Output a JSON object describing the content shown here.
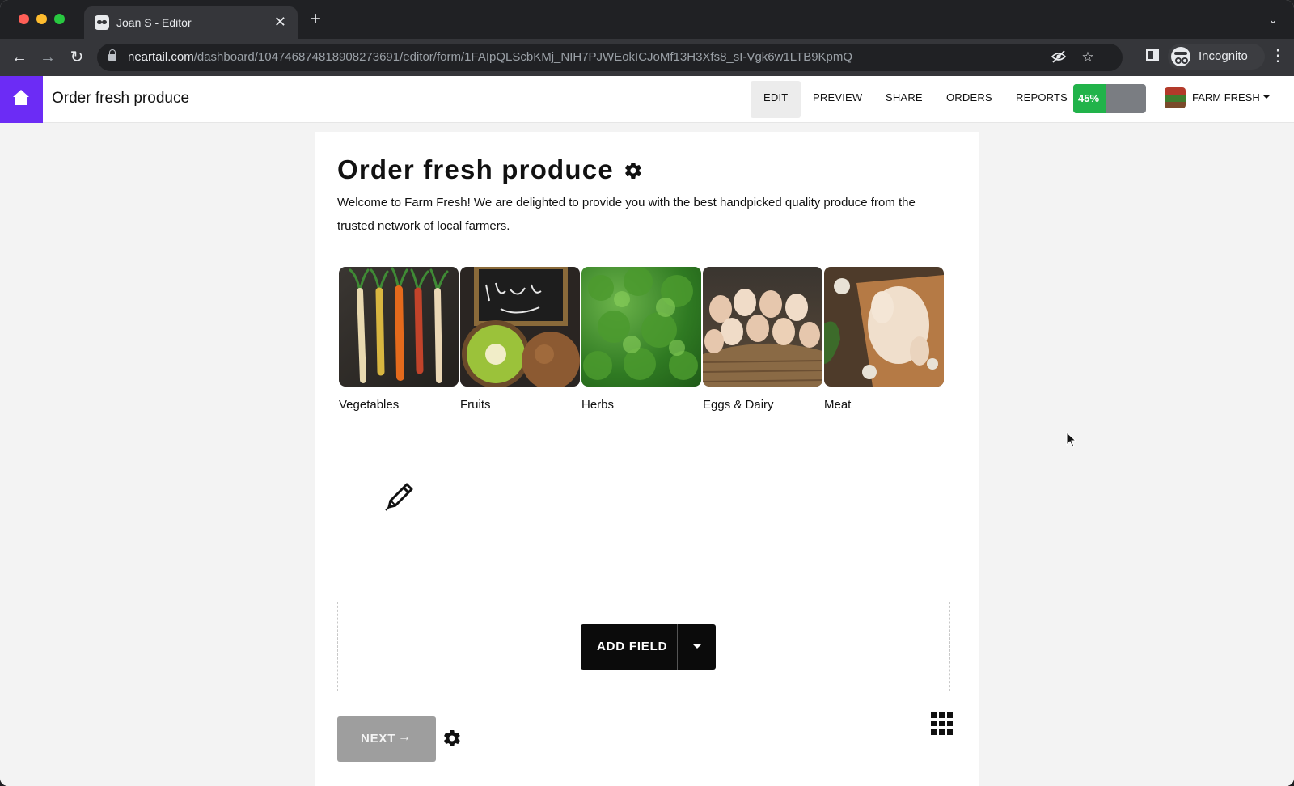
{
  "browser": {
    "tab_title": "Joan S - Editor",
    "tab_close": "✕",
    "new_tab": "+",
    "url_domain": "neartail.com",
    "url_path": "/dashboard/104746874818908273691/editor/form/1FAIpQLScbKMj_NIH7PJWEokICJoMf13H3Xfs8_sI-Vgk6w1LTB9KpmQ",
    "profile_label": "Incognito"
  },
  "header": {
    "title": "Order fresh produce",
    "nav": [
      "EDIT",
      "PREVIEW",
      "SHARE",
      "ORDERS",
      "REPORTS"
    ],
    "active_nav": "EDIT",
    "progress_label": "45%",
    "progress_value": 0.45,
    "account_label": "FARM FRESH"
  },
  "form": {
    "title": "Order fresh produce",
    "description": "Welcome to Farm Fresh! We are delighted to provide you with the best handpicked quality produce from the trusted network of local farmers.",
    "categories": [
      {
        "label": "Vegetables",
        "image": "carrots"
      },
      {
        "label": "Fruits",
        "image": "kiwi"
      },
      {
        "label": "Herbs",
        "image": "cilantro"
      },
      {
        "label": "Eggs & Dairy",
        "image": "eggs-basket"
      },
      {
        "label": "Meat",
        "image": "chicken"
      }
    ],
    "add_field_label": "ADD FIELD",
    "next_label": "NEXT",
    "next_arrow": "→"
  },
  "colors": {
    "brand_purple": "#6c2cf5",
    "progress_green": "#21b34a",
    "button_black": "#0b0b0b",
    "button_disabled": "#9e9e9e"
  },
  "icons": [
    "home-icon",
    "gear-icon",
    "pencil-icon",
    "grid-icon",
    "lock-icon",
    "star-icon",
    "eye-off-icon",
    "caret-down-icon"
  ]
}
